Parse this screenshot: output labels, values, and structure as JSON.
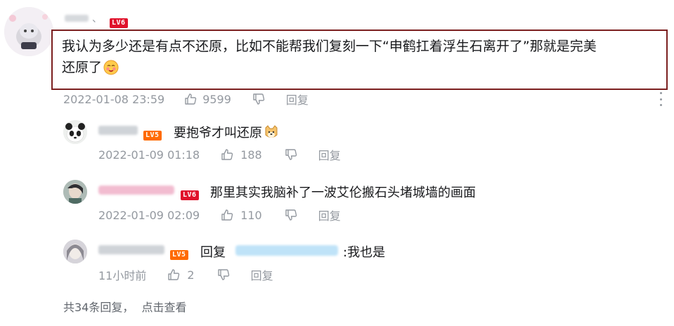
{
  "main_comment": {
    "level_badge": "LV6",
    "text": "我认为多少还是有点不还原，比如不能帮我们复刻一下“申鹤扛着浮生石离开了”那就是完美还原了",
    "text_line1": "我认为多少还是有点不还原，比如不能帮我们复刻一下“申鹤扛着浮生石离开了”那就是完美",
    "text_line2": "还原了",
    "timestamp": "2022-01-08 23:59",
    "likes": "9599",
    "reply_label": "回复"
  },
  "replies": [
    {
      "level_badge": "LV5",
      "text": "要抱爷才叫还原",
      "timestamp": "2022-01-09 01:18",
      "likes": "188",
      "reply_label": "回复"
    },
    {
      "level_badge": "LV6",
      "text": "那里其实我脑补了一波艾伦搬石头堵城墙的画面",
      "timestamp": "2022-01-09 02:09",
      "likes": "110",
      "reply_label": "回复"
    },
    {
      "level_badge": "LV5",
      "reply_prefix": "回复",
      "text": ":我也是",
      "timestamp": "11小时前",
      "likes": "2",
      "reply_label": "回复"
    }
  ],
  "footer": {
    "summary": "共34条回复，",
    "action": "点击查看"
  },
  "colors": {
    "text": "#18191c",
    "meta": "#9499a0",
    "lv6": "#e0132c",
    "lv5": "#ff6a00",
    "highlight_border": "#7b1f1f"
  },
  "icons": {
    "like": "thumb-up-icon",
    "dislike": "thumb-down-icon",
    "more": "more-vertical-icon"
  }
}
